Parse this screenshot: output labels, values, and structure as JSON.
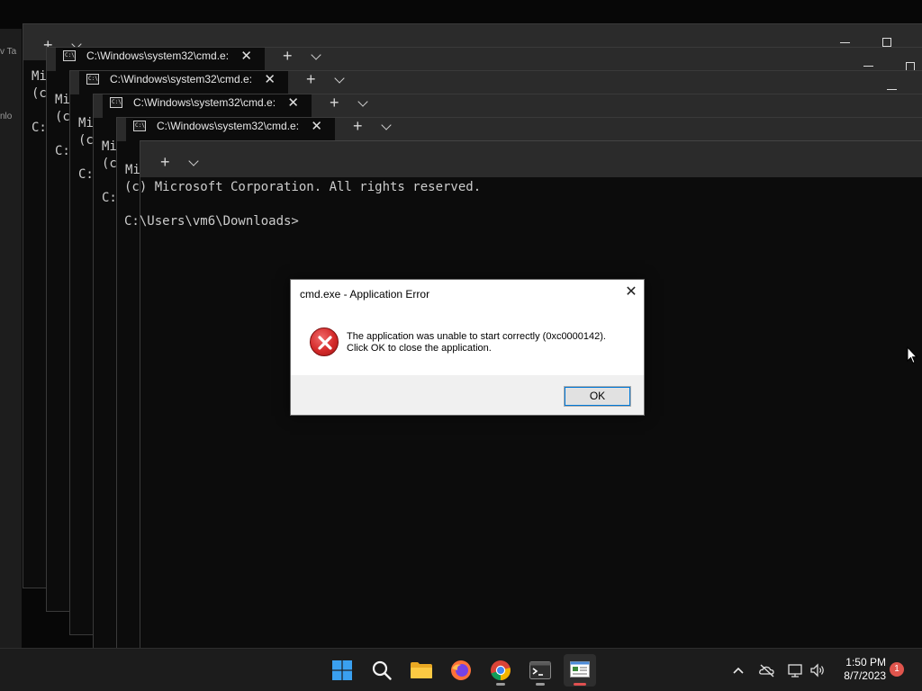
{
  "background_window": {
    "fragments": [
      "v Ta",
      "nlo"
    ]
  },
  "terminal": {
    "tab_title": "C:\\Windows\\system32\\cmd.e:",
    "new_tab_symbol": "+",
    "partial_line_1": "Mi",
    "partial_line_2": "(c",
    "partial_line_3": "C:",
    "copyright_line": "(c) Microsoft Corporation. All rights reserved.",
    "prompt_line": "C:\\Users\\vm6\\Downloads>"
  },
  "dialog": {
    "title": "cmd.exe - Application Error",
    "close_symbol": "✕",
    "message_line1": "The application was unable to start correctly (0xc0000142).",
    "message_line2": "Click OK to close the application.",
    "ok_label": "OK",
    "icon": "error-icon"
  },
  "taskbar": {
    "apps": [
      {
        "name": "start",
        "icon": "windows-logo-icon"
      },
      {
        "name": "search",
        "icon": "search-icon"
      },
      {
        "name": "file-explorer",
        "icon": "folder-icon"
      },
      {
        "name": "firefox",
        "icon": "firefox-icon"
      },
      {
        "name": "chrome",
        "icon": "chrome-icon"
      },
      {
        "name": "terminal",
        "icon": "terminal-icon"
      },
      {
        "name": "cmd-error",
        "icon": "app-window-icon"
      }
    ],
    "time": "1:50 PM",
    "date": "8/7/2023",
    "notification_count": "1"
  },
  "colors": {
    "terminal_bg": "#0c0c0c",
    "titlebar_bg": "#2b2b2b",
    "taskbar_bg": "#1c1c1c",
    "error_red": "#d42a2a",
    "focus_blue": "#0078d7"
  }
}
